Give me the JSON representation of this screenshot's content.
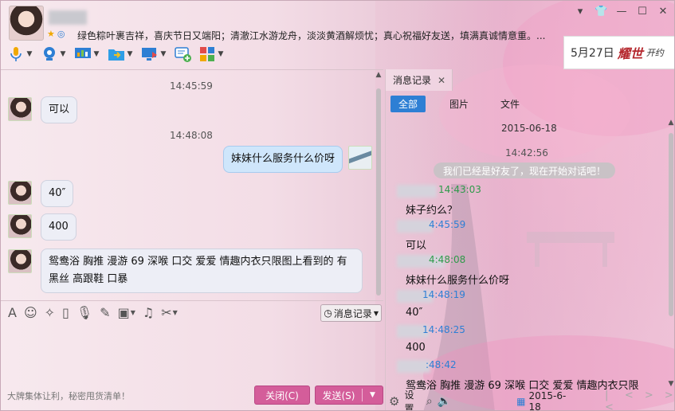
{
  "header": {
    "signature": "绿色粽叶裹吉祥，喜庆节日又端阳；清澈江水游龙舟，淡淡黄酒解烦忧；真心祝福好友送，填满真诚情意重。..."
  },
  "banner": {
    "date": "5月27日",
    "brand": "耀世",
    "suffix": "开约"
  },
  "chat": {
    "messages": [
      {
        "time": "14:45:59",
        "from": "her",
        "text": "可以"
      },
      {
        "time": "14:48:08",
        "from": "me",
        "text": "妹妹什么服务什么价呀"
      },
      {
        "from": "her",
        "text": "40″"
      },
      {
        "from": "her",
        "text": "400"
      },
      {
        "from": "her",
        "text": "鸳鸯浴 胸推 漫游 69 深喉 口交 爱爱 情趣内衣只限图上看到的 有黑丝 高跟鞋 口暴"
      }
    ]
  },
  "input": {
    "history_button": "消息记录",
    "footer_text": "大牌集体让利，秘密甩货清单！",
    "close_label": "关闭(C)",
    "send_label": "发送(S)"
  },
  "history": {
    "tab_label": "消息记录",
    "filters": [
      "全部",
      "图片",
      "文件"
    ],
    "date": "2015-06-18",
    "first_time": "14:42:56",
    "tip": "我们已经是好友了，现在开始对话吧！",
    "entries": [
      {
        "stamp": "14:43:03",
        "text": "妹子约么？"
      },
      {
        "stamp": "4:45:59",
        "text": "可以"
      },
      {
        "stamp": "4:48:08",
        "text": "妹妹什么服务什么价呀"
      },
      {
        "stamp": "14:48:19",
        "text": "40″"
      },
      {
        "stamp": "14:48:25",
        "text": "400"
      },
      {
        "stamp": ":48:42",
        "text": "鸳鸯浴 胸推 漫游 69 深喉 口交 爱爱 情趣内衣只限"
      }
    ],
    "settings_label": "设置",
    "footer_date": "2015-6-18"
  }
}
